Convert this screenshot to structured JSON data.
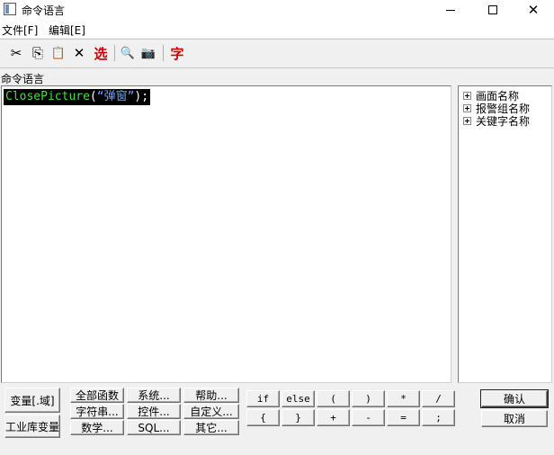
{
  "window": {
    "title": "命令语言"
  },
  "menu": {
    "file": "文件[F]",
    "edit": "编辑[E]"
  },
  "toolbar": {
    "cut": "✂",
    "copy": "⎘",
    "paste": "📋",
    "delete": "✕",
    "select": "选",
    "find": "🔍",
    "replace": "📷",
    "font": "字"
  },
  "editor": {
    "label": "命令语言",
    "code": {
      "fn": "ClosePicture",
      "open": "(",
      "str": "“弹窗”",
      "close": ");"
    }
  },
  "tree": {
    "items": [
      "画面名称",
      "报警组名称",
      "关键字名称"
    ]
  },
  "buttons": {
    "variable": "变量[.域]",
    "industrial_var": "工业库变量",
    "all_functions": "全部函数",
    "string": "字符串...",
    "math": "数学...",
    "system": "系统...",
    "control": "控件...",
    "sql": "SQL...",
    "help": "帮助...",
    "custom": "自定义...",
    "other": "其它...",
    "confirm": "确认",
    "cancel": "取消"
  },
  "keys": {
    "row1": [
      "if",
      "else",
      "(",
      ")",
      "*",
      "/"
    ],
    "row2": [
      "{",
      "}",
      "+",
      "-",
      "=",
      ";"
    ]
  }
}
